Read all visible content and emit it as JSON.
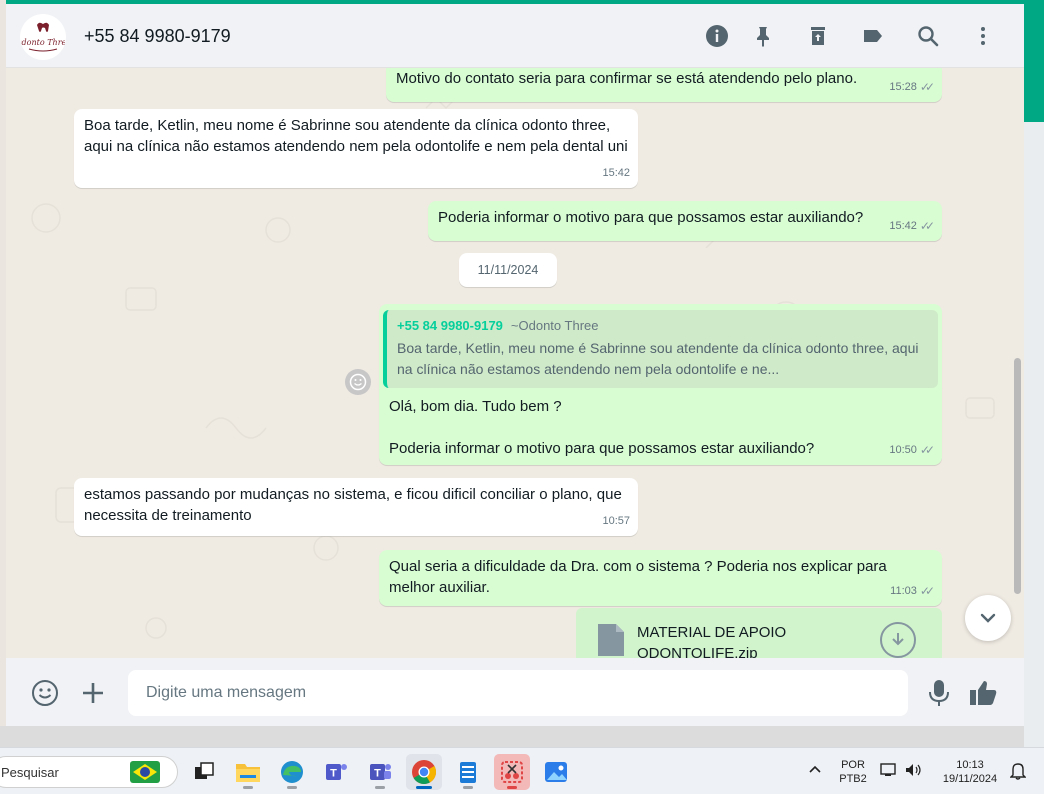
{
  "header": {
    "contact_name": "+55 84 9980-9179",
    "logo_text": "Odonto Three",
    "icons": [
      "info-icon",
      "pin-icon",
      "delete-icon",
      "label-icon",
      "search-icon",
      "menu-icon"
    ]
  },
  "messages": [
    {
      "direction": "out",
      "text": "Motivo do contato seria para confirmar se está atendendo pelo plano.",
      "time": "15:28"
    },
    {
      "direction": "in",
      "text": "Boa tarde, Ketlin, meu nome é Sabrinne sou atendente da clínica odonto three, aqui na clínica não estamos atendendo nem pela odontolife e nem pela dental uni",
      "time": "15:42"
    },
    {
      "direction": "out",
      "text": "Poderia informar o motivo para que possamos estar auxiliando?",
      "time": "15:42"
    },
    {
      "direction": "out",
      "quote": {
        "number": "+55 84 9980-9179",
        "name": "~Odonto Three",
        "text": "Boa tarde, Ketlin, meu nome é Sabrinne sou atendente da clínica odonto three, aqui na clínica não estamos atendendo nem pela odontolife e ne..."
      },
      "line1": "Olá, bom dia. Tudo bem ?",
      "line2": "Poderia informar o motivo para que possamos estar auxiliando?",
      "time": "10:50"
    },
    {
      "direction": "in",
      "text": "estamos passando por mudanças no sistema, e ficou dificil conciliar o plano, que necessita de treinamento",
      "time": "10:57"
    },
    {
      "direction": "out",
      "text": "Qual seria a dificuldade da Dra. com o sistema ? Poderia nos explicar para melhor auxiliar.",
      "time": "11:03"
    }
  ],
  "date_chip": "11/11/2024",
  "file": {
    "name_line1": "MATERIAL DE APOIO",
    "name_line2": "ODONTOLIFE.zip"
  },
  "composer": {
    "placeholder": "Digite uma mensagem"
  },
  "taskbar": {
    "search_text": "Pesquisar",
    "language": "POR",
    "keyboard": "PTB2",
    "time": "10:13",
    "date": "19/11/2024"
  }
}
